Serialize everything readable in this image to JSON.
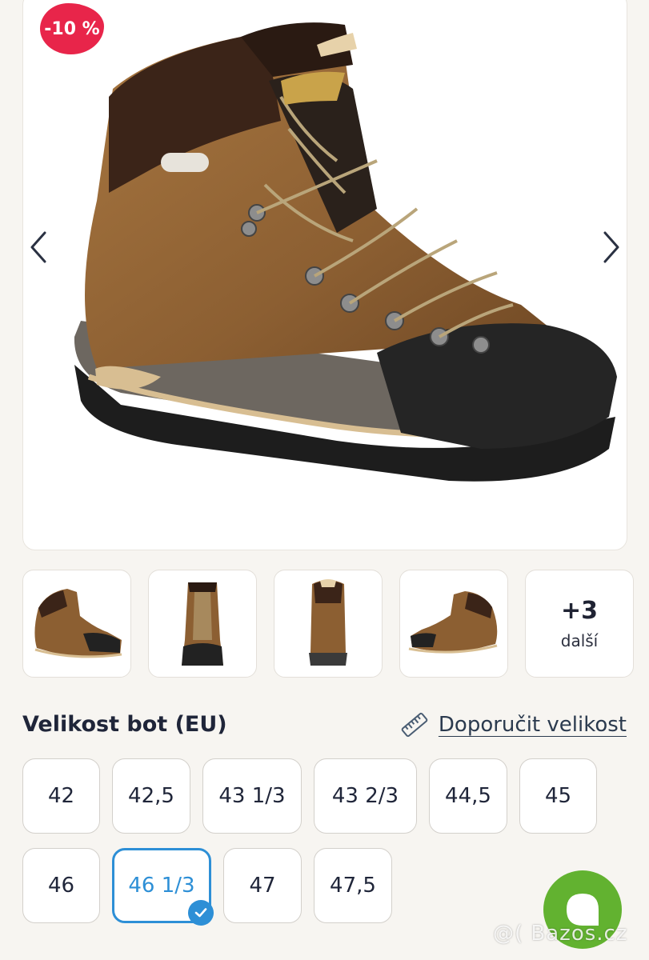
{
  "product": {
    "discount_badge": "-10 %",
    "hero_image": "hiking-boot-side-view",
    "thumbnails": [
      "boot-side",
      "boot-front",
      "boot-back",
      "boot-inner-side"
    ],
    "more_count": "+3",
    "more_label": "další"
  },
  "sizes": {
    "title": "Velikost bot (EU)",
    "recommend_label": "Doporučit velikost",
    "options": [
      "42",
      "42,5",
      "43 1/3",
      "43 2/3",
      "44,5",
      "45",
      "46",
      "46 1/3",
      "47",
      "47,5"
    ],
    "selected": "46 1/3"
  },
  "watermark": "@( Bazos.cz",
  "colors": {
    "accent": "#2d8fd6",
    "badge": "#e8254a",
    "chat": "#62b230"
  }
}
